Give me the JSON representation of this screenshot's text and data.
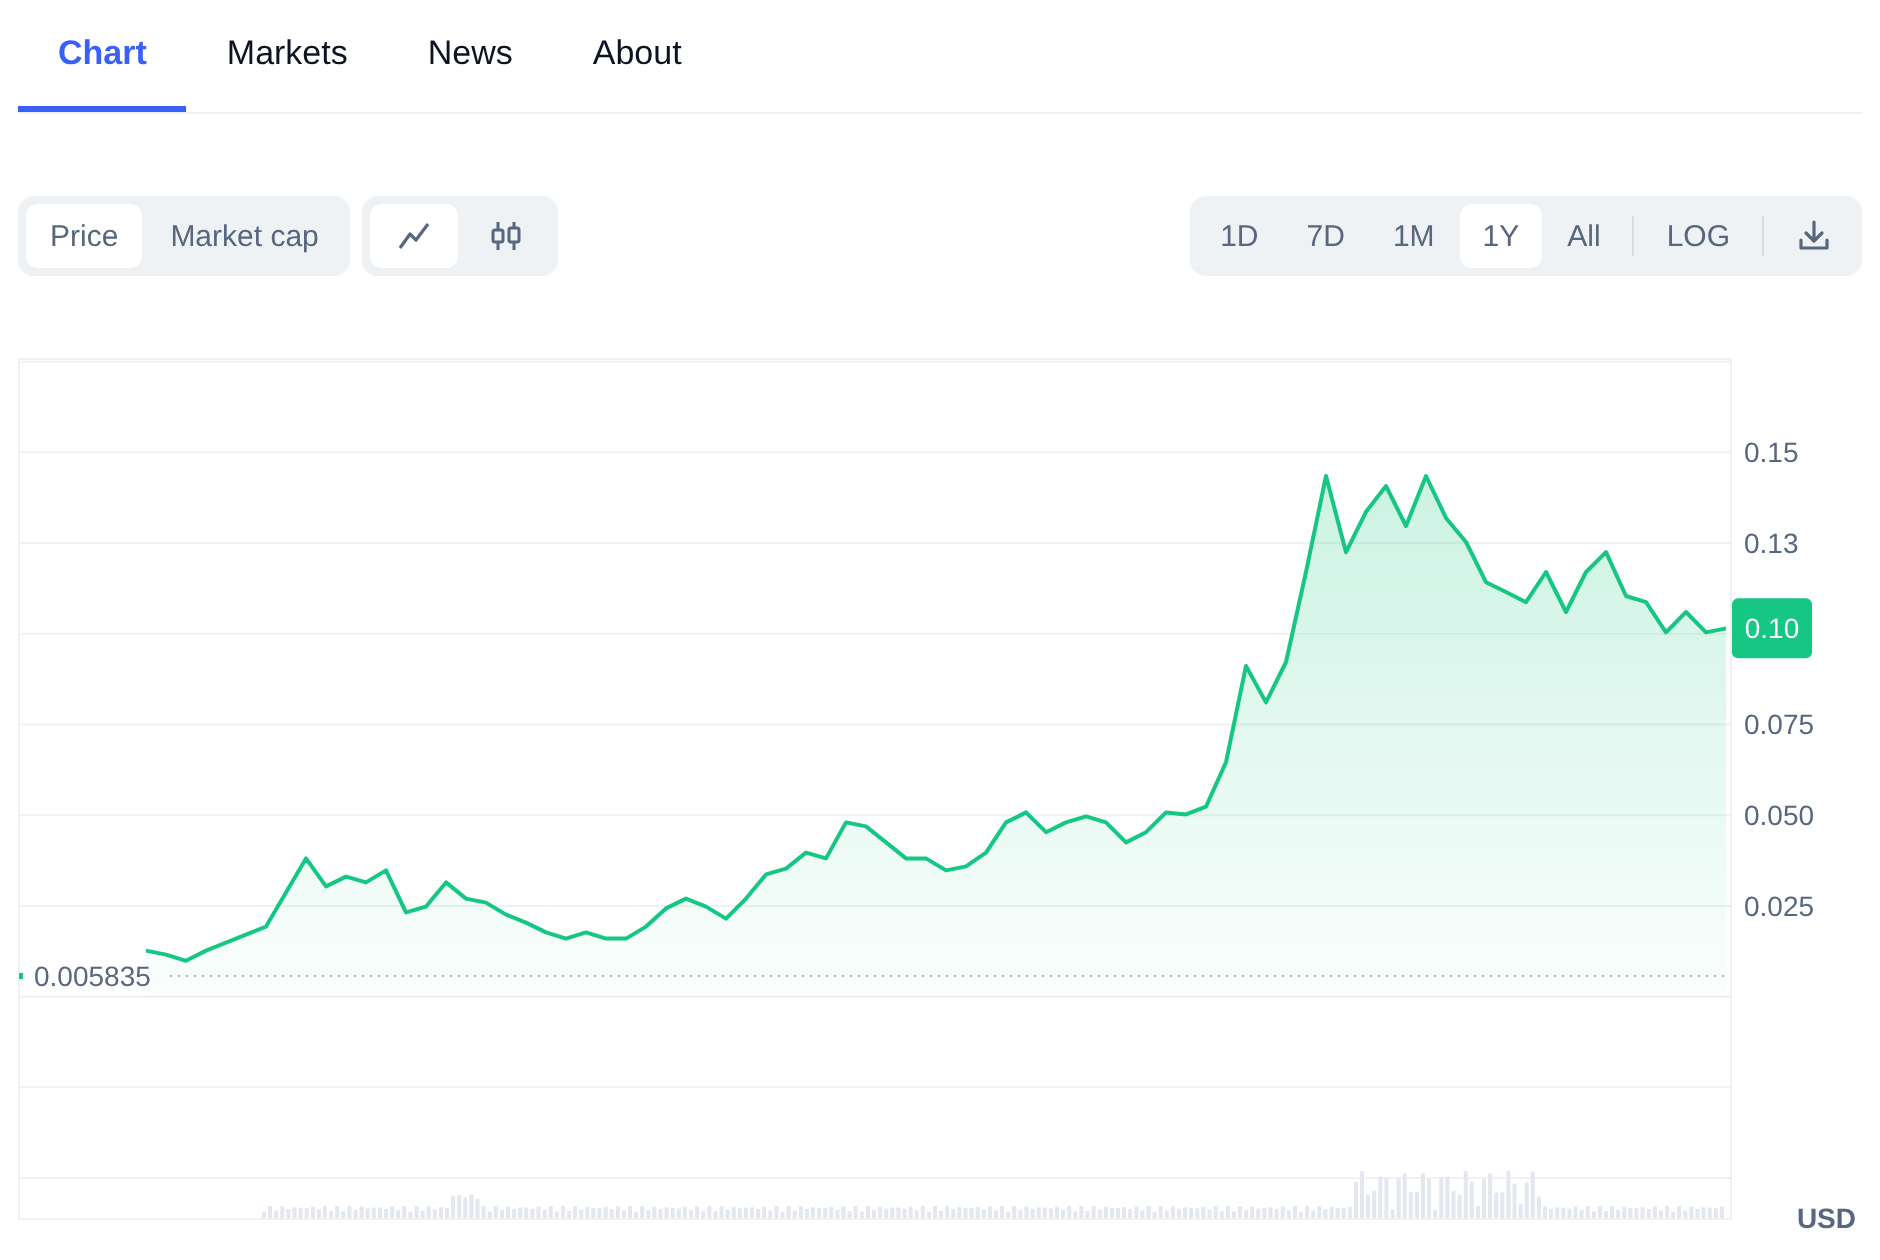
{
  "tabs": [
    {
      "label": "Chart",
      "selected": true
    },
    {
      "label": "Markets",
      "selected": false
    },
    {
      "label": "News",
      "selected": false
    },
    {
      "label": "About",
      "selected": false
    }
  ],
  "metric_toggle": [
    {
      "label": "Price",
      "selected": true
    },
    {
      "label": "Market cap",
      "selected": false
    }
  ],
  "chart_style_toggle": [
    {
      "kind": "line",
      "selected": true
    },
    {
      "kind": "candlestick",
      "selected": false
    }
  ],
  "ranges": [
    {
      "label": "1D",
      "selected": false
    },
    {
      "label": "7D",
      "selected": false
    },
    {
      "label": "1M",
      "selected": false
    },
    {
      "label": "1Y",
      "selected": true
    },
    {
      "label": "All",
      "selected": false
    }
  ],
  "scale_button": {
    "label": "LOG"
  },
  "price_chart": {
    "current_price": "0.10",
    "reference_label": "0.005835",
    "currency": "USD",
    "chart_data": {
      "type": "area",
      "grid": true,
      "ylim": [
        -0.061,
        0.176
      ],
      "yticks": [
        {
          "value": 0.025,
          "label": "0.025"
        },
        {
          "value": 0.05,
          "label": "0.050"
        },
        {
          "value": 0.075,
          "label": "0.075"
        },
        {
          "value": 0.125,
          "label": "0.13"
        },
        {
          "value": 0.15,
          "label": "0.15"
        }
      ],
      "series": [
        {
          "color": "#16c784",
          "values": [
            0.0127,
            0.0116,
            0.0099,
            0.0127,
            0.0149,
            0.0171,
            0.0193,
            0.0287,
            0.0381,
            0.0304,
            0.0331,
            0.0315,
            0.0348,
            0.0232,
            0.0248,
            0.0315,
            0.027,
            0.0259,
            0.0226,
            0.0204,
            0.0177,
            0.016,
            0.0177,
            0.016,
            0.016,
            0.0193,
            0.0243,
            0.027,
            0.0248,
            0.0215,
            0.027,
            0.0337,
            0.0353,
            0.0397,
            0.0381,
            0.048,
            0.0469,
            0.0425,
            0.0381,
            0.0381,
            0.0348,
            0.0359,
            0.0397,
            0.048,
            0.0508,
            0.0453,
            0.048,
            0.0497,
            0.048,
            0.0425,
            0.0453,
            0.0508,
            0.0502,
            0.0524,
            0.0646,
            0.0911,
            0.0811,
            0.0922,
            0.117,
            0.1435,
            0.1225,
            0.1336,
            0.1407,
            0.1297,
            0.1435,
            0.1319,
            0.1253,
            0.1142,
            0.1115,
            0.1087,
            0.117,
            0.106,
            0.117,
            0.1225,
            0.1104,
            0.1087,
            0.1004,
            0.106,
            0.1004,
            0.1015
          ]
        }
      ]
    }
  }
}
